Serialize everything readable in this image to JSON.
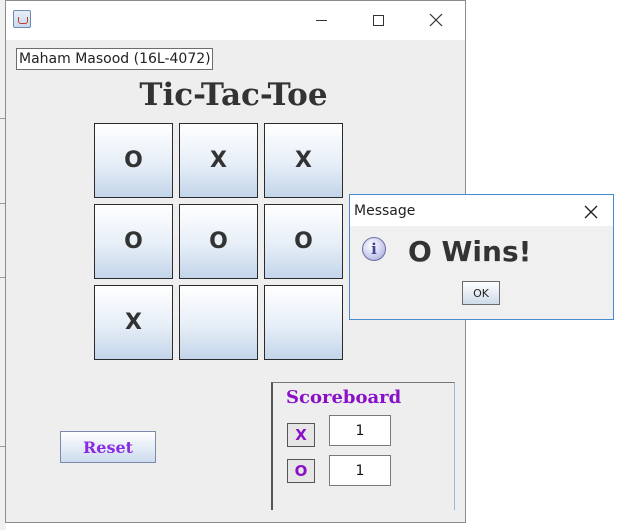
{
  "player_name": "Maham Masood (16L-4072)",
  "game_title": "Tic-Tac-Toe",
  "board": [
    [
      "O",
      "X",
      "X"
    ],
    [
      "O",
      "O",
      "O"
    ],
    [
      "X",
      "",
      ""
    ]
  ],
  "reset_label": "Reset",
  "scoreboard": {
    "title": "Scoreboard",
    "rows": [
      {
        "player": "X",
        "score": "1"
      },
      {
        "player": "O",
        "score": "1"
      }
    ]
  },
  "dialog": {
    "title": "Message",
    "message": "O Wins!",
    "ok_label": "OK"
  },
  "colors": {
    "accent_purple": "#8a10c8",
    "dialog_border": "#4a8ad0"
  },
  "icons": {
    "app": "java-app-icon",
    "minimize": "minimize-icon",
    "maximize": "maximize-icon",
    "close": "close-icon",
    "info": "info-icon"
  }
}
